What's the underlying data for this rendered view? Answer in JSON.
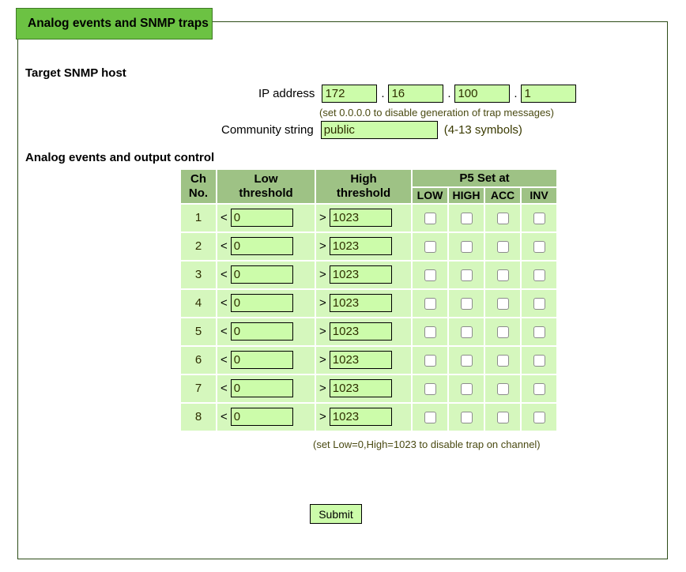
{
  "window": {
    "tab_title": "Analog events and SNMP traps"
  },
  "colors": {
    "tab_green": "#6cc243",
    "frame_border": "#2c4c17",
    "table_header_green": "#9ec285",
    "table_row_green": "#d5f7bd",
    "input_green": "#ccfcaa",
    "hint_text": "#4a4a12"
  },
  "snmp_host": {
    "heading": "Target SNMP host",
    "ip_label": "IP address",
    "ip_octets": [
      "172",
      "16",
      "100",
      "1"
    ],
    "ip_separator": ".",
    "ip_hint": "(set 0.0.0.0 to disable generation of trap messages)",
    "community_label": "Community string",
    "community_value": "public",
    "community_placeholder": "",
    "community_hint": "(4-13 symbols)"
  },
  "analog_events": {
    "heading": "Analog events and output control",
    "headers": {
      "ch_no": "Ch No.",
      "ch_no_line1": "Ch",
      "ch_no_line2": "No.",
      "low_line1": "Low",
      "low_line2": "threshold",
      "high_line1": "High",
      "high_line2": "threshold",
      "p5_group": "P5 Set at",
      "sub_low": "LOW",
      "sub_high": "HIGH",
      "sub_acc": "ACC",
      "sub_inv": "INV"
    },
    "low_operator": "<",
    "high_operator": ">",
    "rows": [
      {
        "ch": "1",
        "low": "0",
        "high": "1023",
        "low_cb": false,
        "high_cb": false,
        "acc_cb": false,
        "inv_cb": false
      },
      {
        "ch": "2",
        "low": "0",
        "high": "1023",
        "low_cb": false,
        "high_cb": false,
        "acc_cb": false,
        "inv_cb": false
      },
      {
        "ch": "3",
        "low": "0",
        "high": "1023",
        "low_cb": false,
        "high_cb": false,
        "acc_cb": false,
        "inv_cb": false
      },
      {
        "ch": "4",
        "low": "0",
        "high": "1023",
        "low_cb": false,
        "high_cb": false,
        "acc_cb": false,
        "inv_cb": false
      },
      {
        "ch": "5",
        "low": "0",
        "high": "1023",
        "low_cb": false,
        "high_cb": false,
        "acc_cb": false,
        "inv_cb": false
      },
      {
        "ch": "6",
        "low": "0",
        "high": "1023",
        "low_cb": false,
        "high_cb": false,
        "acc_cb": false,
        "inv_cb": false
      },
      {
        "ch": "7",
        "low": "0",
        "high": "1023",
        "low_cb": false,
        "high_cb": false,
        "acc_cb": false,
        "inv_cb": false
      },
      {
        "ch": "8",
        "low": "0",
        "high": "1023",
        "low_cb": false,
        "high_cb": false,
        "acc_cb": false,
        "inv_cb": false
      }
    ],
    "table_hint": "(set Low=0,High=1023 to disable trap on channel)"
  },
  "actions": {
    "submit_label": "Submit"
  }
}
